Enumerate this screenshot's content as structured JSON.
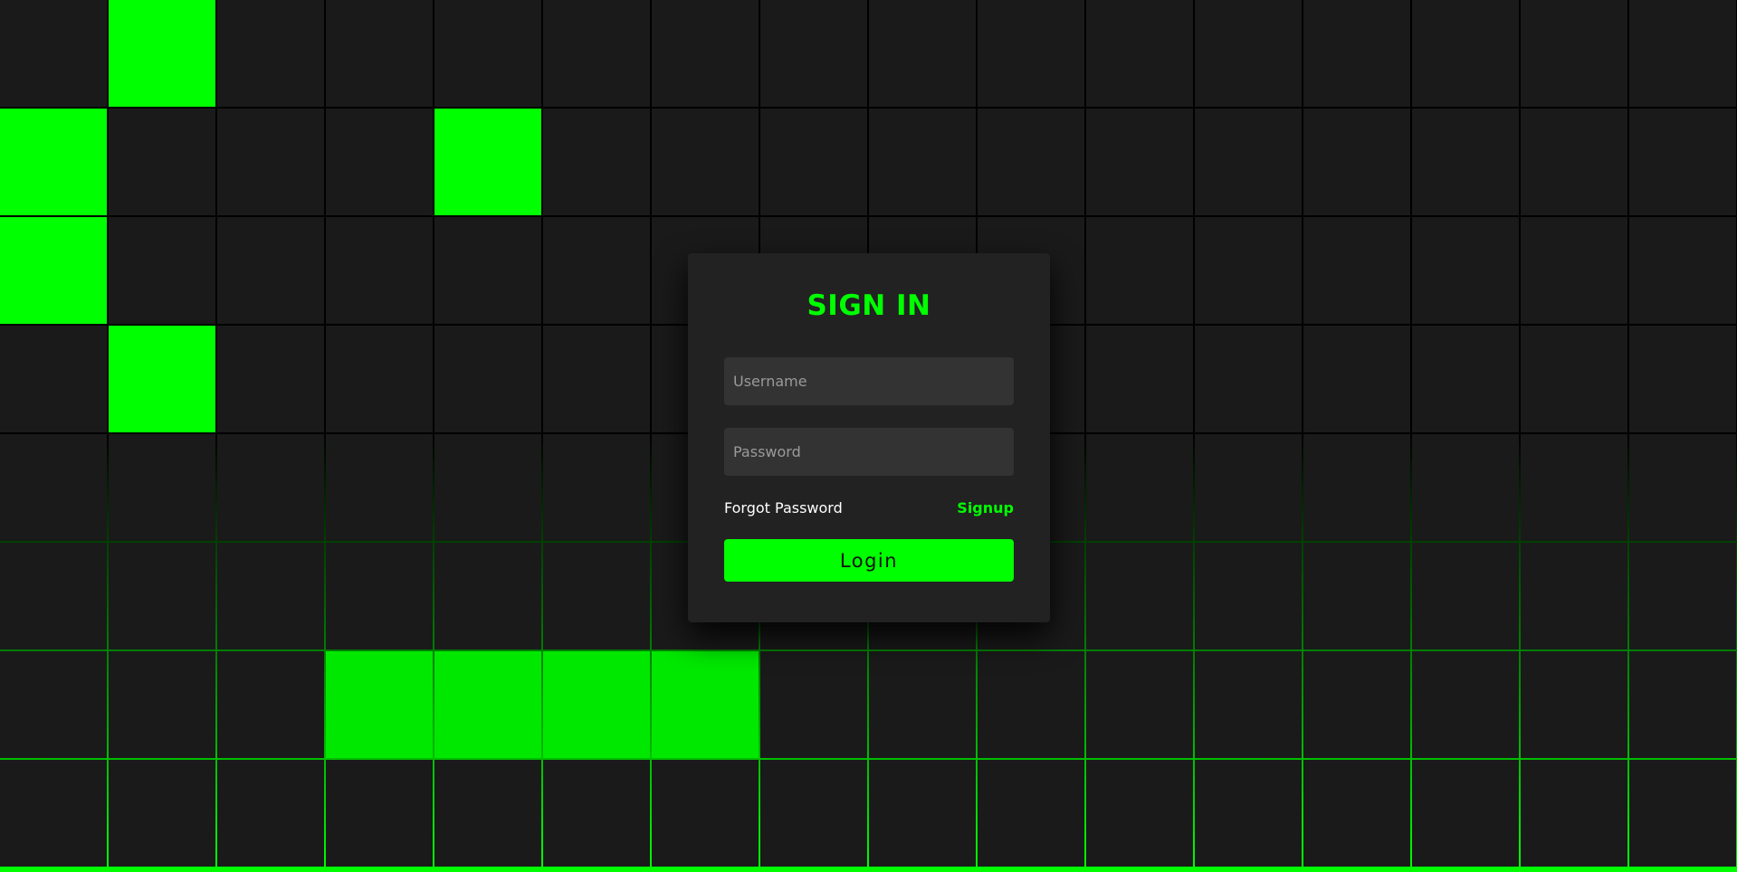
{
  "colors": {
    "accent": "#00ff00",
    "background": "#000000",
    "cell": "#1a1a1a",
    "card": "#222222",
    "input": "#333333"
  },
  "background_grid": {
    "columns": 16,
    "rows": 8,
    "lit_cells": [
      [
        0,
        1
      ],
      [
        1,
        0
      ],
      [
        1,
        4
      ],
      [
        2,
        0
      ],
      [
        3,
        1
      ],
      [
        6,
        3
      ],
      [
        6,
        4
      ],
      [
        6,
        5
      ],
      [
        6,
        6
      ]
    ]
  },
  "login_form": {
    "title": "SIGN IN",
    "username_placeholder": "Username",
    "password_placeholder": "Password",
    "forgot_password": "Forgot Password",
    "signup": "Signup",
    "login_button": "Login"
  }
}
